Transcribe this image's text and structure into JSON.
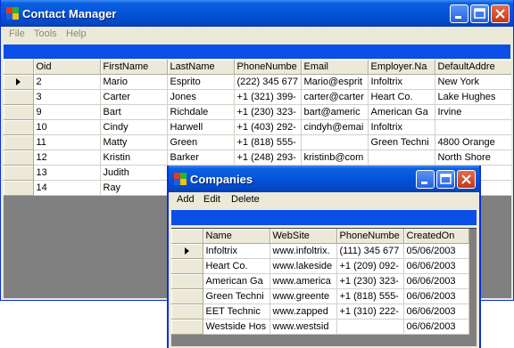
{
  "main_window": {
    "title": "Contact Manager",
    "menu": [
      "File",
      "Tools",
      "Help"
    ],
    "columns": [
      "Oid",
      "FirstName",
      "LastName",
      "PhoneNumbe",
      "Email",
      "Employer.Na",
      "DefaultAddre"
    ],
    "rows": [
      [
        "2",
        "Mario",
        "Esprito",
        "(222) 345 677",
        "Mario@esprit",
        "Infoltrix",
        "New York"
      ],
      [
        "3",
        "Carter",
        "Jones",
        "+1 (321) 399-",
        "carter@carter",
        "Heart Co.",
        "Lake Hughes"
      ],
      [
        "9",
        "Bart",
        "Richdale",
        "+1 (230) 323-",
        "bart@americ",
        "American Ga",
        "Irvine"
      ],
      [
        "10",
        "Cindy",
        "Harwell",
        "+1 (403) 292-",
        "cindyh@emai",
        "Infoltrix",
        ""
      ],
      [
        "11",
        "Matty",
        "Green",
        "+1 (818) 555-",
        "",
        "Green Techni",
        "4800 Orange"
      ],
      [
        "12",
        "Kristin",
        "Barker",
        "+1 (248) 293-",
        "kristinb@com",
        "",
        "North Shore"
      ],
      [
        "13",
        "Judith",
        "",
        "",
        "",
        "",
        ""
      ],
      [
        "14",
        "Ray",
        "",
        "",
        "",
        "",
        "d"
      ]
    ],
    "selected_row": 0
  },
  "companies_window": {
    "title": "Companies",
    "menu": [
      "Add",
      "Edit",
      "Delete"
    ],
    "columns": [
      "Name",
      "WebSite",
      "PhoneNumbe",
      "CreatedOn"
    ],
    "rows": [
      [
        "Infoltrix",
        "www.infoltrix.",
        "(111) 345 677",
        "05/06/2003"
      ],
      [
        "Heart Co.",
        "www.lakeside",
        "+1 (209) 092-",
        "06/06/2003"
      ],
      [
        "American Ga",
        "www.america",
        "+1 (230) 323-",
        "06/06/2003"
      ],
      [
        "Green Techni",
        "www.greente",
        "+1 (818) 555-",
        "06/06/2003"
      ],
      [
        "EET Technic",
        "www.zapped",
        "+1 (310) 222-",
        "06/06/2003"
      ],
      [
        "Westside Hos",
        "www.westsid",
        "",
        "06/06/2003"
      ]
    ],
    "selected_row": 0
  },
  "colors": {
    "titlebar": "#0553d8",
    "toolbar_strip": "#0b4ee8",
    "grid_background": "#808080",
    "chrome": "#ece9d8"
  }
}
